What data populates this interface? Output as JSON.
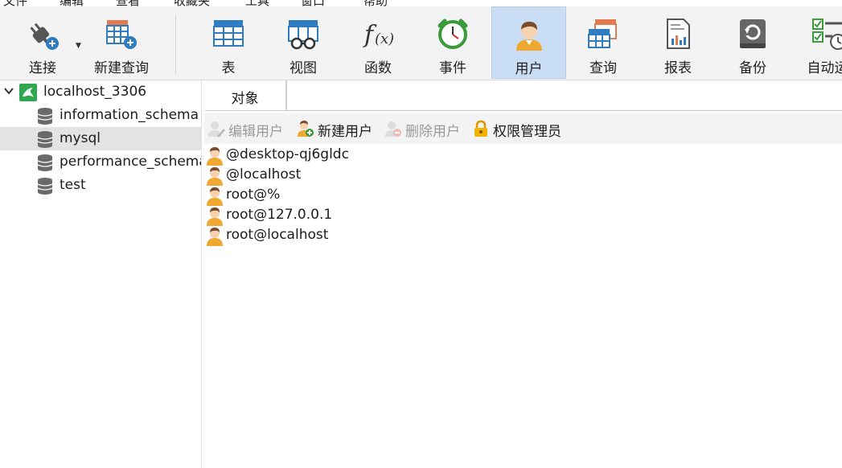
{
  "menubar": [
    "文件",
    "编辑",
    "查看",
    "收藏夹",
    "工具",
    "窗口",
    "帮助"
  ],
  "toolbar": {
    "items": [
      {
        "key": "connect",
        "label": "连接",
        "icon": "plug-connect-icon"
      },
      {
        "key": "new_query",
        "label": "新建查询",
        "icon": "table-add-icon"
      },
      {
        "key": "table",
        "label": "表",
        "icon": "table-icon"
      },
      {
        "key": "view",
        "label": "视图",
        "icon": "view-glasses-icon"
      },
      {
        "key": "function",
        "label": "函数",
        "icon": "function-fx-icon"
      },
      {
        "key": "event",
        "label": "事件",
        "icon": "alarm-clock-icon"
      },
      {
        "key": "user",
        "label": "用户",
        "icon": "user-icon",
        "active": true
      },
      {
        "key": "query",
        "label": "查询",
        "icon": "query-table-icon"
      },
      {
        "key": "report",
        "label": "报表",
        "icon": "report-icon"
      },
      {
        "key": "backup",
        "label": "备份",
        "icon": "backup-icon"
      },
      {
        "key": "automation",
        "label": "自动运",
        "icon": "automation-checklist-icon"
      }
    ]
  },
  "tree": {
    "connection": {
      "label": "localhost_3306",
      "icon": "mysql-dolphin-icon"
    },
    "databases": [
      {
        "label": "information_schema",
        "selected": false
      },
      {
        "label": "mysql",
        "selected": true
      },
      {
        "label": "performance_schema",
        "selected": false
      },
      {
        "label": "test",
        "selected": false
      }
    ]
  },
  "tabs": {
    "objects": "对象"
  },
  "actions": {
    "edit_user": "编辑用户",
    "new_user": "新建用户",
    "delete_user": "删除用户",
    "privilege_manager": "权限管理员"
  },
  "users": [
    "@desktop-qj6gldc",
    "@localhost",
    "root@%",
    "root@127.0.0.1",
    "root@localhost"
  ],
  "colors": {
    "accent": "#c9def5",
    "toolbar_bg": "#f3f3f3",
    "user_icon": "#f0a830",
    "blue": "#2f7cc0"
  }
}
